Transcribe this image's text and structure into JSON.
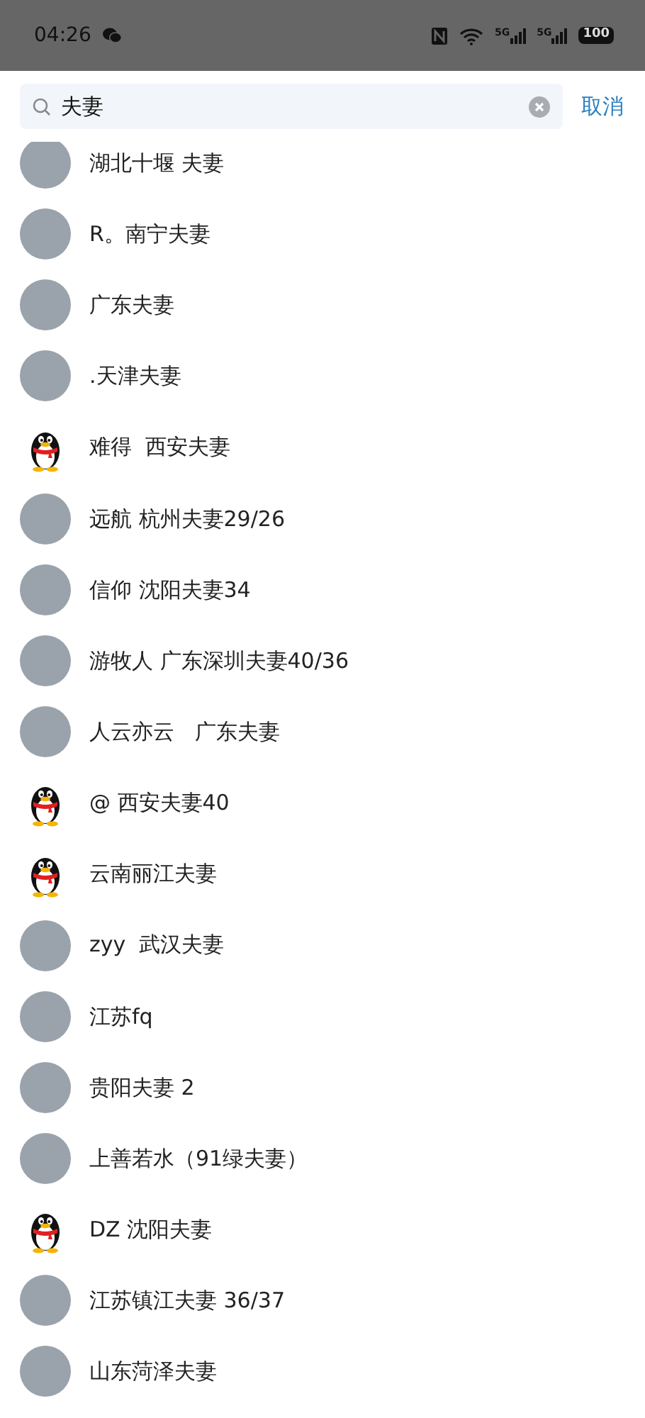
{
  "status_bar": {
    "time": "04:26",
    "network_labels": [
      "5G",
      "5G"
    ],
    "battery": "100"
  },
  "search": {
    "value": "夫妻",
    "cancel": "取消"
  },
  "results": [
    {
      "name": "湖北十堰 夫妻",
      "kind": "photo"
    },
    {
      "name": "R。南宁夫妻",
      "kind": "photo"
    },
    {
      "name": "广东夫妻",
      "kind": "photo"
    },
    {
      "name": ".天津夫妻",
      "kind": "photo"
    },
    {
      "name": "难得  西安夫妻",
      "kind": "default"
    },
    {
      "name": "远航 杭州夫妻29/26",
      "kind": "photo"
    },
    {
      "name": "信仰 沈阳夫妻34",
      "kind": "photo"
    },
    {
      "name": "游牧人 广东深圳夫妻40/36",
      "kind": "photo"
    },
    {
      "name": "人云亦云   广东夫妻",
      "kind": "photo"
    },
    {
      "name": "@ 西安夫妻40",
      "kind": "default"
    },
    {
      "name": "云南丽江夫妻",
      "kind": "default"
    },
    {
      "name": "zyy  武汉夫妻",
      "kind": "photo"
    },
    {
      "name": "江苏fq",
      "kind": "photo"
    },
    {
      "name": "贵阳夫妻 2",
      "kind": "photo"
    },
    {
      "name": "上善若水（91绿夫妻）",
      "kind": "photo"
    },
    {
      "name": "DZ 沈阳夫妻",
      "kind": "default"
    },
    {
      "name": "江苏镇江夫妻 36/37",
      "kind": "photo"
    },
    {
      "name": "山东菏泽夫妻",
      "kind": "photo"
    }
  ]
}
